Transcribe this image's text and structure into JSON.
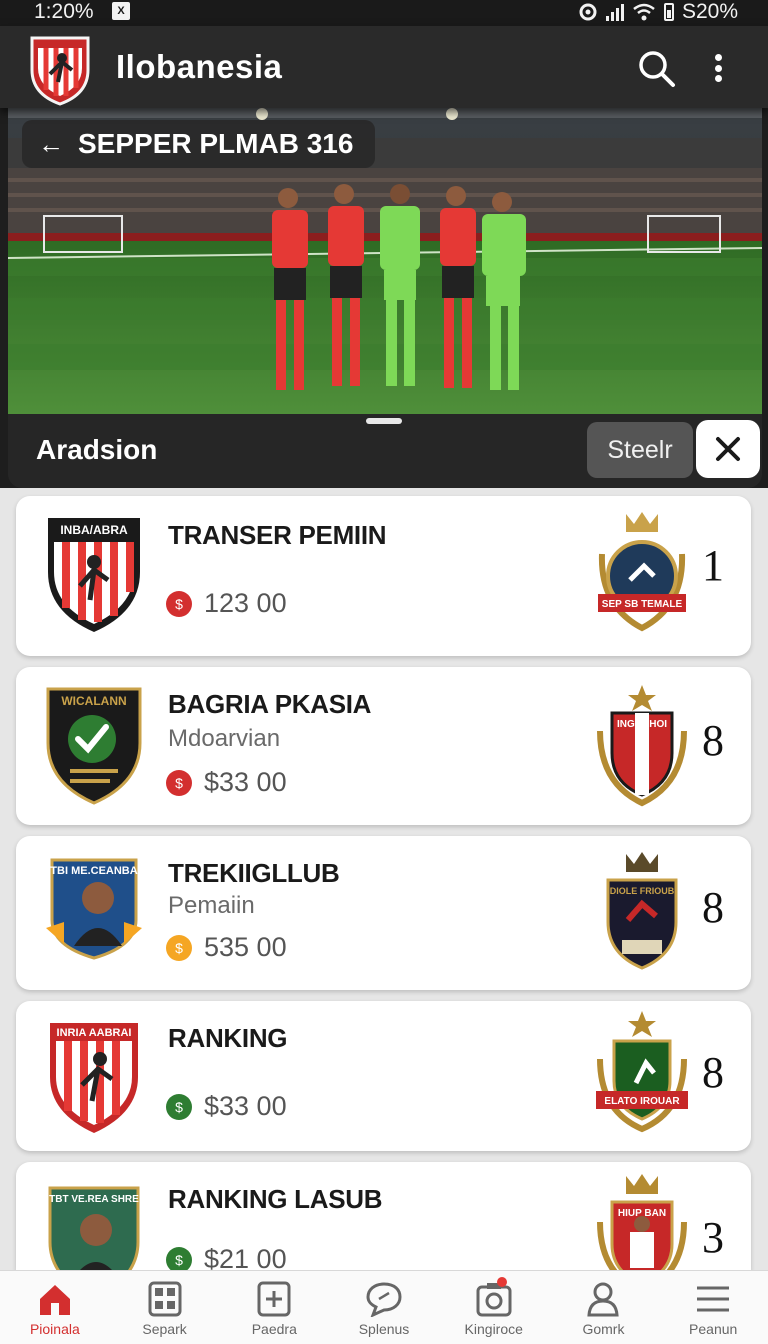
{
  "status_bar": {
    "time": "1:20%",
    "battery": "S20%",
    "left_icon": "X"
  },
  "app_bar": {
    "title": "Ilobanesia"
  },
  "hero": {
    "back_label": "SEPPER PLMAB 316",
    "sheet_title": "Aradsion",
    "select_label": "Steelr"
  },
  "cards": [
    {
      "badge_text": "INBA/ABRA",
      "name": "TRANSER PEMIIN",
      "sub": "",
      "price": "123 00",
      "icon_color": "#d32f2f",
      "crest_text": "SEP SB TEMALE",
      "rank": "1"
    },
    {
      "badge_text": "WICALANN",
      "name": "BAGRIA PKASIA",
      "sub": "Mdoarvian",
      "price": "$33 00",
      "icon_color": "#d32f2f",
      "crest_text": "INGRAHOI",
      "rank": "8"
    },
    {
      "badge_text": "TBI ME.CEANBA",
      "name": "TREKIIGLLUB",
      "sub": "Pemaiin",
      "price": "535 00",
      "icon_color": "#f5a623",
      "crest_text": "DIOLE FRIOUB",
      "rank": "8"
    },
    {
      "badge_text": "INRIA AABRAI",
      "name": "RANKING",
      "sub": "",
      "price": "$33 00",
      "icon_color": "#2e7d32",
      "crest_text": "ELATO IROUAR",
      "rank": "8"
    },
    {
      "badge_text": "TBT VE.REA SHRE",
      "name": "RANKING LASUB",
      "sub": "",
      "price": "$21 00",
      "icon_color": "#2e7d32",
      "crest_text": "HIUP BAN",
      "rank": "3"
    }
  ],
  "bottom_nav": [
    {
      "label": "Pioinala",
      "icon": "home-icon"
    },
    {
      "label": "Separk",
      "icon": "grid-icon"
    },
    {
      "label": "Paedra",
      "icon": "add-box-icon"
    },
    {
      "label": "Splenus",
      "icon": "chat-icon"
    },
    {
      "label": "Kingiroce",
      "icon": "camera-icon"
    },
    {
      "label": "Gomrk",
      "icon": "person-icon"
    },
    {
      "label": "Peanun",
      "icon": "menu-icon"
    }
  ],
  "colors": {
    "accent": "#d32f2f",
    "jersey_red": "#e53935",
    "jersey_green": "#7ed957",
    "pitch": "#3f7d2e"
  }
}
